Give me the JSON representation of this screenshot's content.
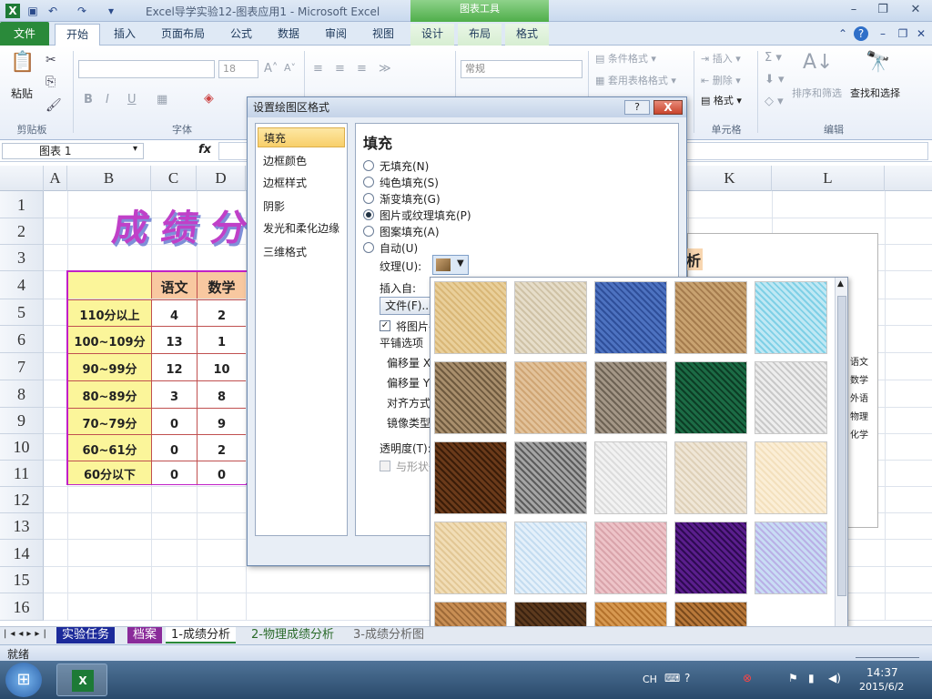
{
  "app_title": "Excel导学实验12-图表应用1 - Microsoft Excel",
  "context_tools_label": "图表工具",
  "tabs": [
    {
      "label": "文件"
    },
    {
      "label": "开始"
    },
    {
      "label": "插入"
    },
    {
      "label": "页面布局"
    },
    {
      "label": "公式"
    },
    {
      "label": "数据"
    },
    {
      "label": "审阅"
    },
    {
      "label": "视图"
    },
    {
      "label": "设计"
    },
    {
      "label": "布局"
    },
    {
      "label": "格式"
    }
  ],
  "ribbon": {
    "clipboard": {
      "paste": "粘贴",
      "group": "剪贴板"
    },
    "font": {
      "size": "18",
      "group": "字体",
      "bold": "B",
      "italic": "I",
      "underline": "U"
    },
    "number": {
      "format": "常规"
    },
    "styles": {
      "conditional": "条件格式",
      "table": "套用表格格式"
    },
    "cells": {
      "insert": "插入",
      "delete": "删除",
      "format": "格式",
      "group": "单元格"
    },
    "editing": {
      "sort": "排序和筛选",
      "find": "查找和选择",
      "group": "编辑"
    }
  },
  "formula_bar": {
    "name_box": "图表 1",
    "fx": "fx"
  },
  "columns": [
    "A",
    "B",
    "C",
    "D",
    "K",
    "L"
  ],
  "rows": [
    "1",
    "2",
    "3",
    "4",
    "5",
    "6",
    "7",
    "8",
    "9",
    "10",
    "11",
    "12",
    "13",
    "14",
    "15",
    "16"
  ],
  "sheet_title_art": "成绩分",
  "table": {
    "headers": [
      "语文",
      "数学"
    ],
    "rows": [
      {
        "label": "110分以上",
        "c": "4",
        "d": "2"
      },
      {
        "label": "100~109分",
        "c": "13",
        "d": "1"
      },
      {
        "label": "90~99分",
        "c": "12",
        "d": "10"
      },
      {
        "label": "80~89分",
        "c": "3",
        "d": "8"
      },
      {
        "label": "70~79分",
        "c": "0",
        "d": "9"
      },
      {
        "label": "60~61分",
        "c": "0",
        "d": "2"
      },
      {
        "label": "60分以下",
        "c": "0",
        "d": "0"
      }
    ]
  },
  "chart_behind": {
    "title_fragment": "析",
    "legend": [
      "语文",
      "数学",
      "外语",
      "物理",
      "化学"
    ]
  },
  "dialog": {
    "title": "设置绘图区格式",
    "help": "?",
    "close": "X",
    "nav": [
      "填充",
      "边框颜色",
      "边框样式",
      "阴影",
      "发光和柔化边缘",
      "三维格式"
    ],
    "pane_title": "填充",
    "options": [
      "无填充(N)",
      "纯色填充(S)",
      "渐变填充(G)",
      "图片或纹理填充(P)",
      "图案填充(A)",
      "自动(U)"
    ],
    "texture_label": "纹理(U):",
    "insert_from": "插入自:",
    "file_button": "文件(F)...",
    "tile_checkbox": "将图片平",
    "tile_options": "平铺选项",
    "offset_x": "偏移量 X",
    "offset_y": "偏移量 Y",
    "align": "对齐方式",
    "mirror": "镜像类型",
    "transparency": "透明度(T):",
    "rotate_with": "与形状一"
  },
  "textures": [
    {
      "name": "papyrus",
      "c1": "#e9cf9a",
      "c2": "#d9b777"
    },
    {
      "name": "canvas",
      "c1": "#e6ddc9",
      "c2": "#cfc2a6"
    },
    {
      "name": "denim",
      "c1": "#4d72c0",
      "c2": "#2f4f9a"
    },
    {
      "name": "woven-mat",
      "c1": "#c8a270",
      "c2": "#a57c4e"
    },
    {
      "name": "water-droplets",
      "c1": "#bfe8f4",
      "c2": "#7fd0e6"
    },
    {
      "name": "paper-bag",
      "c1": "#a88e6c",
      "c2": "#6f5a3f"
    },
    {
      "name": "fish-fossil",
      "c1": "#e2c29a",
      "c2": "#cfa574"
    },
    {
      "name": "sand",
      "c1": "#a39686",
      "c2": "#6d6254"
    },
    {
      "name": "green-marble",
      "c1": "#1c6b45",
      "c2": "#0c3d25"
    },
    {
      "name": "white-marble",
      "c1": "#ededed",
      "c2": "#c9c9c9"
    },
    {
      "name": "brown-marble",
      "c1": "#6a3a1a",
      "c2": "#3a1c08"
    },
    {
      "name": "granite",
      "c1": "#a4a4a4",
      "c2": "#5c5c5c"
    },
    {
      "name": "newsprint",
      "c1": "#f2f2f2",
      "c2": "#dcdcdc"
    },
    {
      "name": "recycled-paper",
      "c1": "#efe6d6",
      "c2": "#ded0b8"
    },
    {
      "name": "parchment",
      "c1": "#fbeed6",
      "c2": "#f3e0bd"
    },
    {
      "name": "stationery",
      "c1": "#f1ddb6",
      "c2": "#e2c795"
    },
    {
      "name": "blue-tissue-paper",
      "c1": "#e4f0fa",
      "c2": "#c4dcf0"
    },
    {
      "name": "pink-tissue-paper",
      "c1": "#edc3c8",
      "c2": "#d9a4ab"
    },
    {
      "name": "purple-mesh",
      "c1": "#5a1e8c",
      "c2": "#2e0a52"
    },
    {
      "name": "bouquet",
      "c1": "#c8dcf4",
      "c2": "#b9b0e6"
    },
    {
      "name": "cork",
      "c1": "#c88e54",
      "c2": "#9e6a38"
    },
    {
      "name": "walnut",
      "c1": "#5c3a1e",
      "c2": "#3a2210"
    },
    {
      "name": "oak",
      "c1": "#d69850",
      "c2": "#b4722c"
    },
    {
      "name": "medium-wood",
      "c1": "#b8783a",
      "c2": "#7a4a1c"
    }
  ],
  "sheets": [
    "实验任务",
    "档案",
    "1-成绩分析",
    "2-物理成绩分析",
    "3-成绩分析图"
  ],
  "status": "就绪",
  "taskbar": {
    "lang": "CH",
    "time": "14:37",
    "date": "2015/6/2"
  }
}
